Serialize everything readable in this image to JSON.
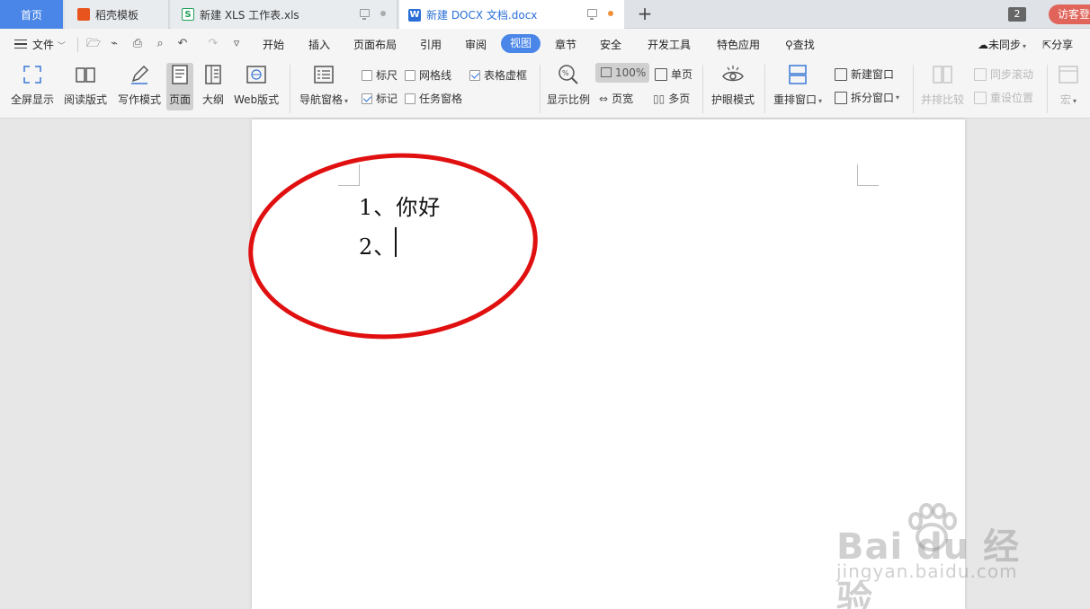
{
  "tabs": {
    "home": "首页",
    "daoke": "稻壳模板",
    "xls": "新建 XLS 工作表.xls",
    "docx": "新建 DOCX 文档.docx",
    "new_tab": "+",
    "window_count": "2",
    "visitor": "访客登"
  },
  "menu": {
    "file": "文件",
    "items": [
      "开始",
      "插入",
      "页面布局",
      "引用",
      "审阅",
      "视图",
      "章节",
      "安全",
      "开发工具",
      "特色应用"
    ],
    "active": "视图",
    "search": "查找",
    "sync": "未同步",
    "share": "分享"
  },
  "ribbon": {
    "fullscreen": "全屏显示",
    "read_mode": "阅读版式",
    "write_mode": "写作模式",
    "page": "页面",
    "outline": "大纲",
    "web": "Web版式",
    "nav_pane": "导航窗格",
    "ruler": "标尺",
    "gridlines": "网格线",
    "table_dashed": "表格虚框",
    "marks": "标记",
    "task_pane": "任务窗格",
    "zoom": "显示比例",
    "zoom_value": "100%",
    "single_page": "单页",
    "page_width": "页宽",
    "multi_page": "多页",
    "eye_mode": "护眼模式",
    "rearrange": "重排窗口",
    "new_window": "新建窗口",
    "split_window": "拆分窗口",
    "side_by_side": "并排比较",
    "sync_scroll": "同步滚动",
    "reset_position": "重设位置",
    "macro": "宏"
  },
  "checkboxes": {
    "ruler": false,
    "gridlines": false,
    "table_dashed": true,
    "marks": true,
    "task_pane": false
  },
  "document": {
    "line1": "1、你好",
    "line2": "2、"
  },
  "watermark": {
    "main": "Bai  du 经验",
    "sub": "jingyan.baidu.com"
  },
  "colors": {
    "accent": "#4a86e8",
    "annotation": "#e01010",
    "visitor_button": "#e0645a"
  }
}
